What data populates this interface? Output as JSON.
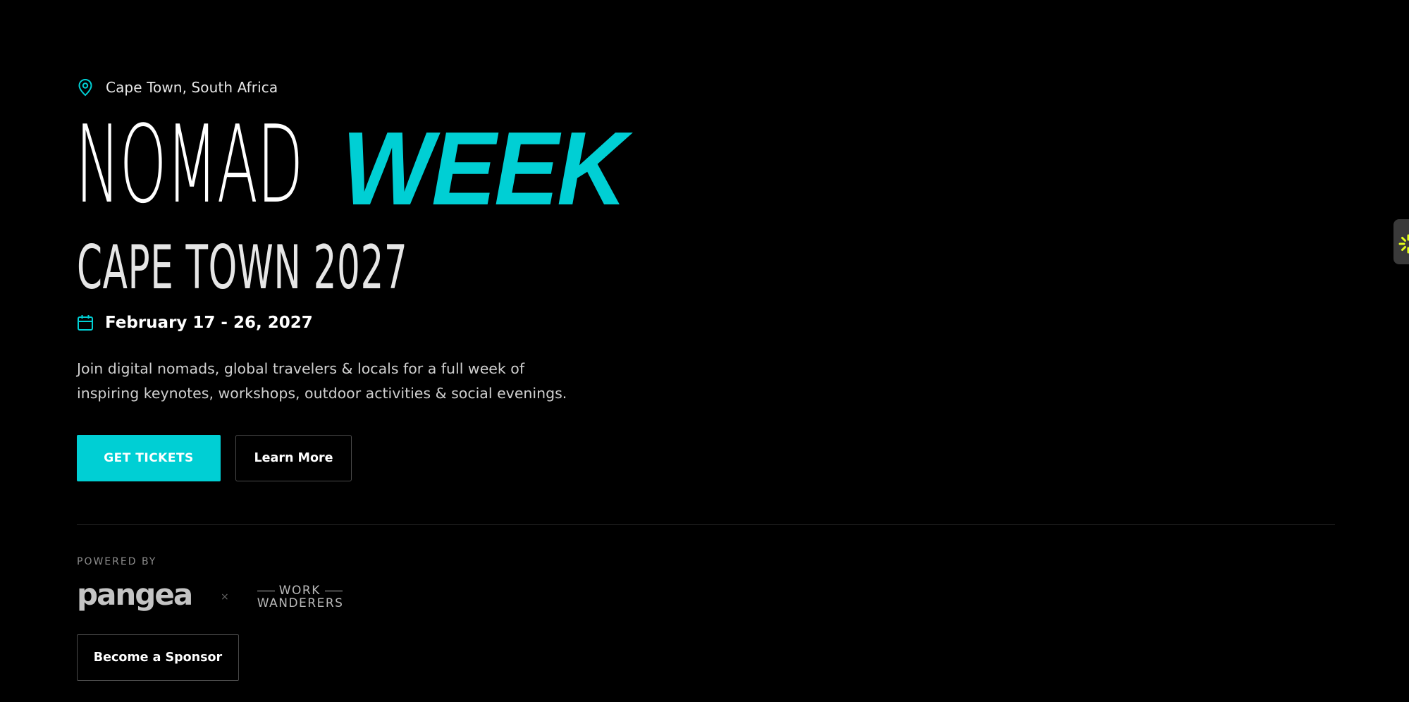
{
  "location": {
    "icon": "map-pin-icon",
    "text": "Cape Town, South Africa"
  },
  "title": {
    "part1": "NOMAD",
    "part2": "WEEK",
    "subtitle": "CAPE TOWN 2027"
  },
  "date": {
    "icon": "calendar-icon",
    "text": "February 17 - 26, 2027"
  },
  "description": {
    "line1": "Join digital nomads, global travelers & locals for a full week of",
    "line2": "inspiring keynotes, workshops, outdoor activities & social evenings."
  },
  "buttons": {
    "primary": "GET TICKETS",
    "secondary": "Learn More"
  },
  "powered_by": {
    "label": "POWERED BY",
    "partner1": "pangea",
    "separator": "×",
    "partner2_line1": "WORK",
    "partner2_line2": "WANDERERS"
  },
  "sponsor_button": "Become a Sponsor",
  "side_widget": {
    "icon": "sparkle-icon"
  },
  "colors": {
    "background": "#000000",
    "accent": "#00cfd4",
    "text": "#ffffff",
    "muted": "#8c8c8c",
    "widget_spark": "#e4ff1a"
  }
}
